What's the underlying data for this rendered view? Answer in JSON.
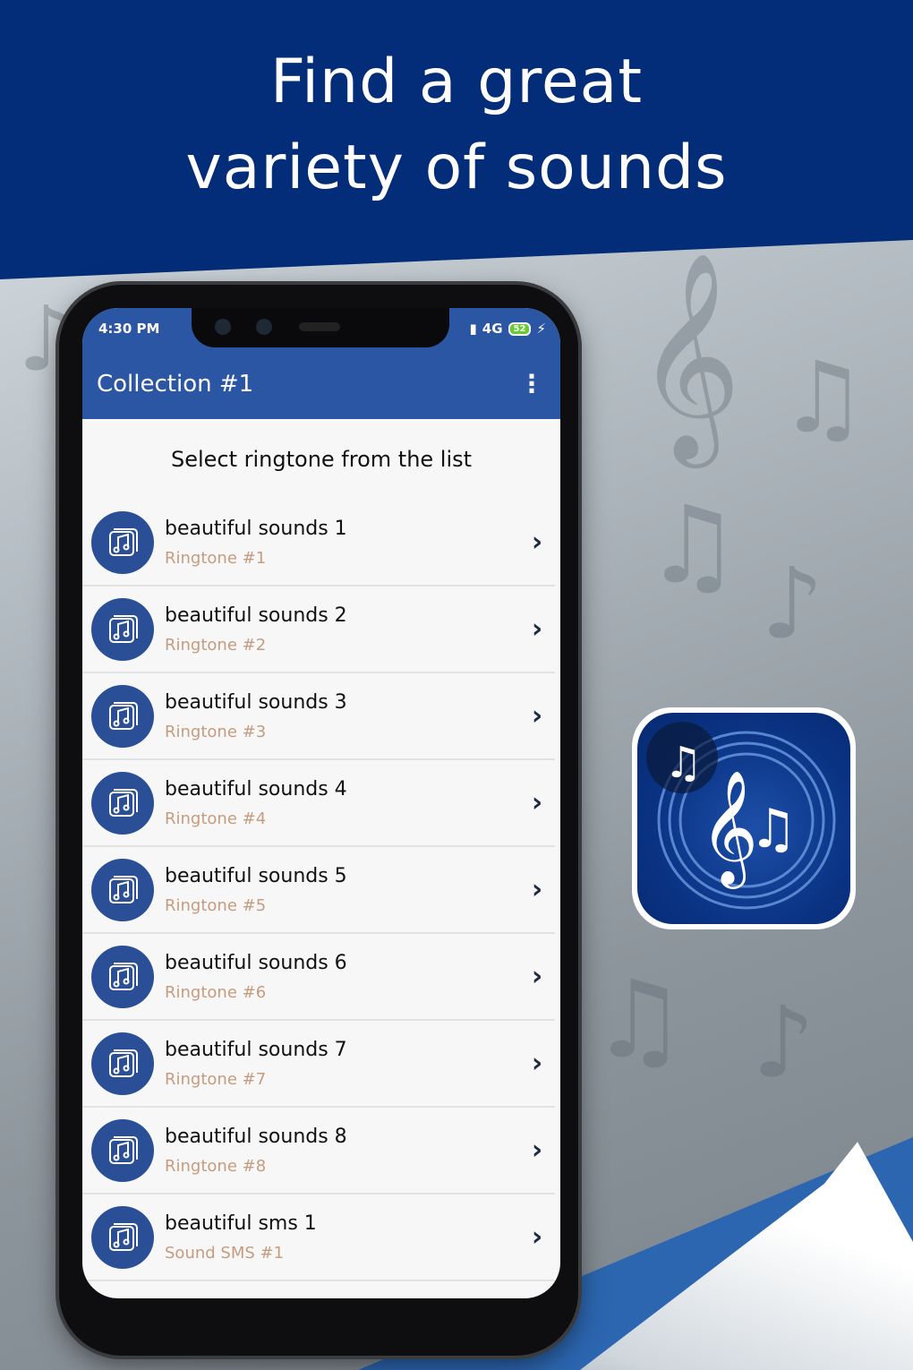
{
  "promo": {
    "headline_line1": "Find a great",
    "headline_line2": "variety of sounds"
  },
  "status_bar": {
    "time": "4:30 PM",
    "network": "4G",
    "battery": "52"
  },
  "app_bar": {
    "title": "Collection #1",
    "menu_icon": "more-vert-icon"
  },
  "list": {
    "heading": "Select ringtone from the list",
    "items": [
      {
        "title": "beautiful sounds 1",
        "subtitle": "Ringtone #1"
      },
      {
        "title": "beautiful sounds 2",
        "subtitle": "Ringtone #2"
      },
      {
        "title": "beautiful sounds 3",
        "subtitle": "Ringtone #3"
      },
      {
        "title": "beautiful sounds 4",
        "subtitle": "Ringtone #4"
      },
      {
        "title": "beautiful sounds 5",
        "subtitle": "Ringtone #5"
      },
      {
        "title": "beautiful sounds 6",
        "subtitle": "Ringtone #6"
      },
      {
        "title": "beautiful sounds 7",
        "subtitle": "Ringtone #7"
      },
      {
        "title": "beautiful sounds 8",
        "subtitle": "Ringtone #8"
      },
      {
        "title": "beautiful sms 1",
        "subtitle": "Sound SMS #1"
      }
    ],
    "item_icon": "music-album-icon",
    "chevron": "›"
  },
  "colors": {
    "banner": "#032d78",
    "app_bar": "#2b56a3",
    "subtitle_text": "#c59c7f"
  }
}
